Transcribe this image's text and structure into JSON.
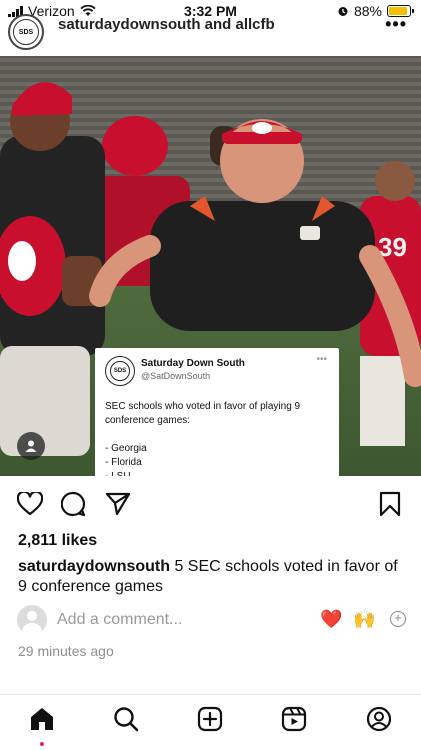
{
  "status_bar": {
    "carrier": "Verizon",
    "time": "3:32 PM",
    "battery_percent": "88%",
    "battery_level": 0.88,
    "battery_color": "#f2c200"
  },
  "post": {
    "username": "saturdaydownsouth",
    "header_text": "saturdaydownsouth and allcfb",
    "avatar_text": "SDS",
    "more_icon": "more-horizontal-icon",
    "tweet": {
      "display_name": "Saturday Down South",
      "handle": "@SatDownSouth",
      "avatar_text": "SDS",
      "text": "SEC schools who voted in favor of playing 9 conference games:\n\n- Georgia\n- Florida\n- LSU\n- Mizzou\n- Texas A&M"
    },
    "likes": "2,811 likes",
    "caption_user": "saturdaydownsouth",
    "caption_text": " 5 SEC schools voted in favor of 9 conference games",
    "comment_placeholder": "Add a comment...",
    "quick_reactions": [
      "❤️",
      "🙌"
    ],
    "timestamp": "29 minutes ago"
  },
  "colors": {
    "accent_red": "#e0245e",
    "bulldog_red": "#ba0c2f",
    "muted_text": "#8e8e8e"
  },
  "bottom_nav": [
    "home-icon",
    "search-icon",
    "create-icon",
    "reels-icon",
    "profile-icon"
  ]
}
